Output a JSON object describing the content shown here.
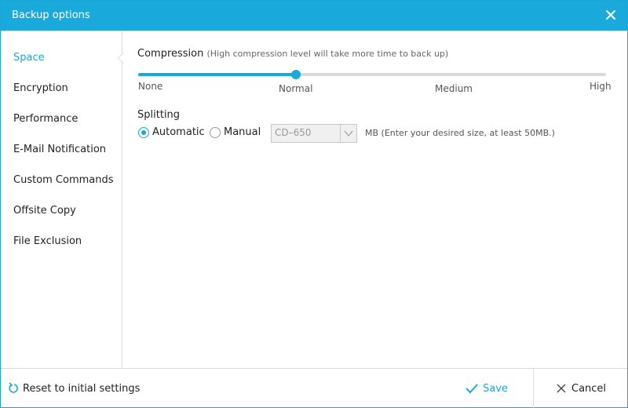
{
  "window": {
    "title": "Backup options"
  },
  "sidebar": {
    "items": [
      {
        "label": "Space",
        "active": true
      },
      {
        "label": "Encryption"
      },
      {
        "label": "Performance"
      },
      {
        "label": "E-Mail Notification"
      },
      {
        "label": "Custom Commands"
      },
      {
        "label": "Offsite Copy"
      },
      {
        "label": "File Exclusion"
      }
    ]
  },
  "compression": {
    "label": "Compression",
    "hint": "(High compression level will take more time to back up)",
    "levels": [
      "None",
      "Normal",
      "Medium",
      "High"
    ],
    "selected": "Normal"
  },
  "splitting": {
    "label": "Splitting",
    "options": [
      "Automatic",
      "Manual"
    ],
    "selected": "Automatic",
    "size_select": {
      "value": "CD–650"
    },
    "unit_hint": "MB (Enter your desired size, at least 50MB.)"
  },
  "footer": {
    "reset_label": "Reset to initial settings",
    "save_label": "Save",
    "cancel_label": "Cancel"
  },
  "colors": {
    "accent": "#1aa9db"
  }
}
